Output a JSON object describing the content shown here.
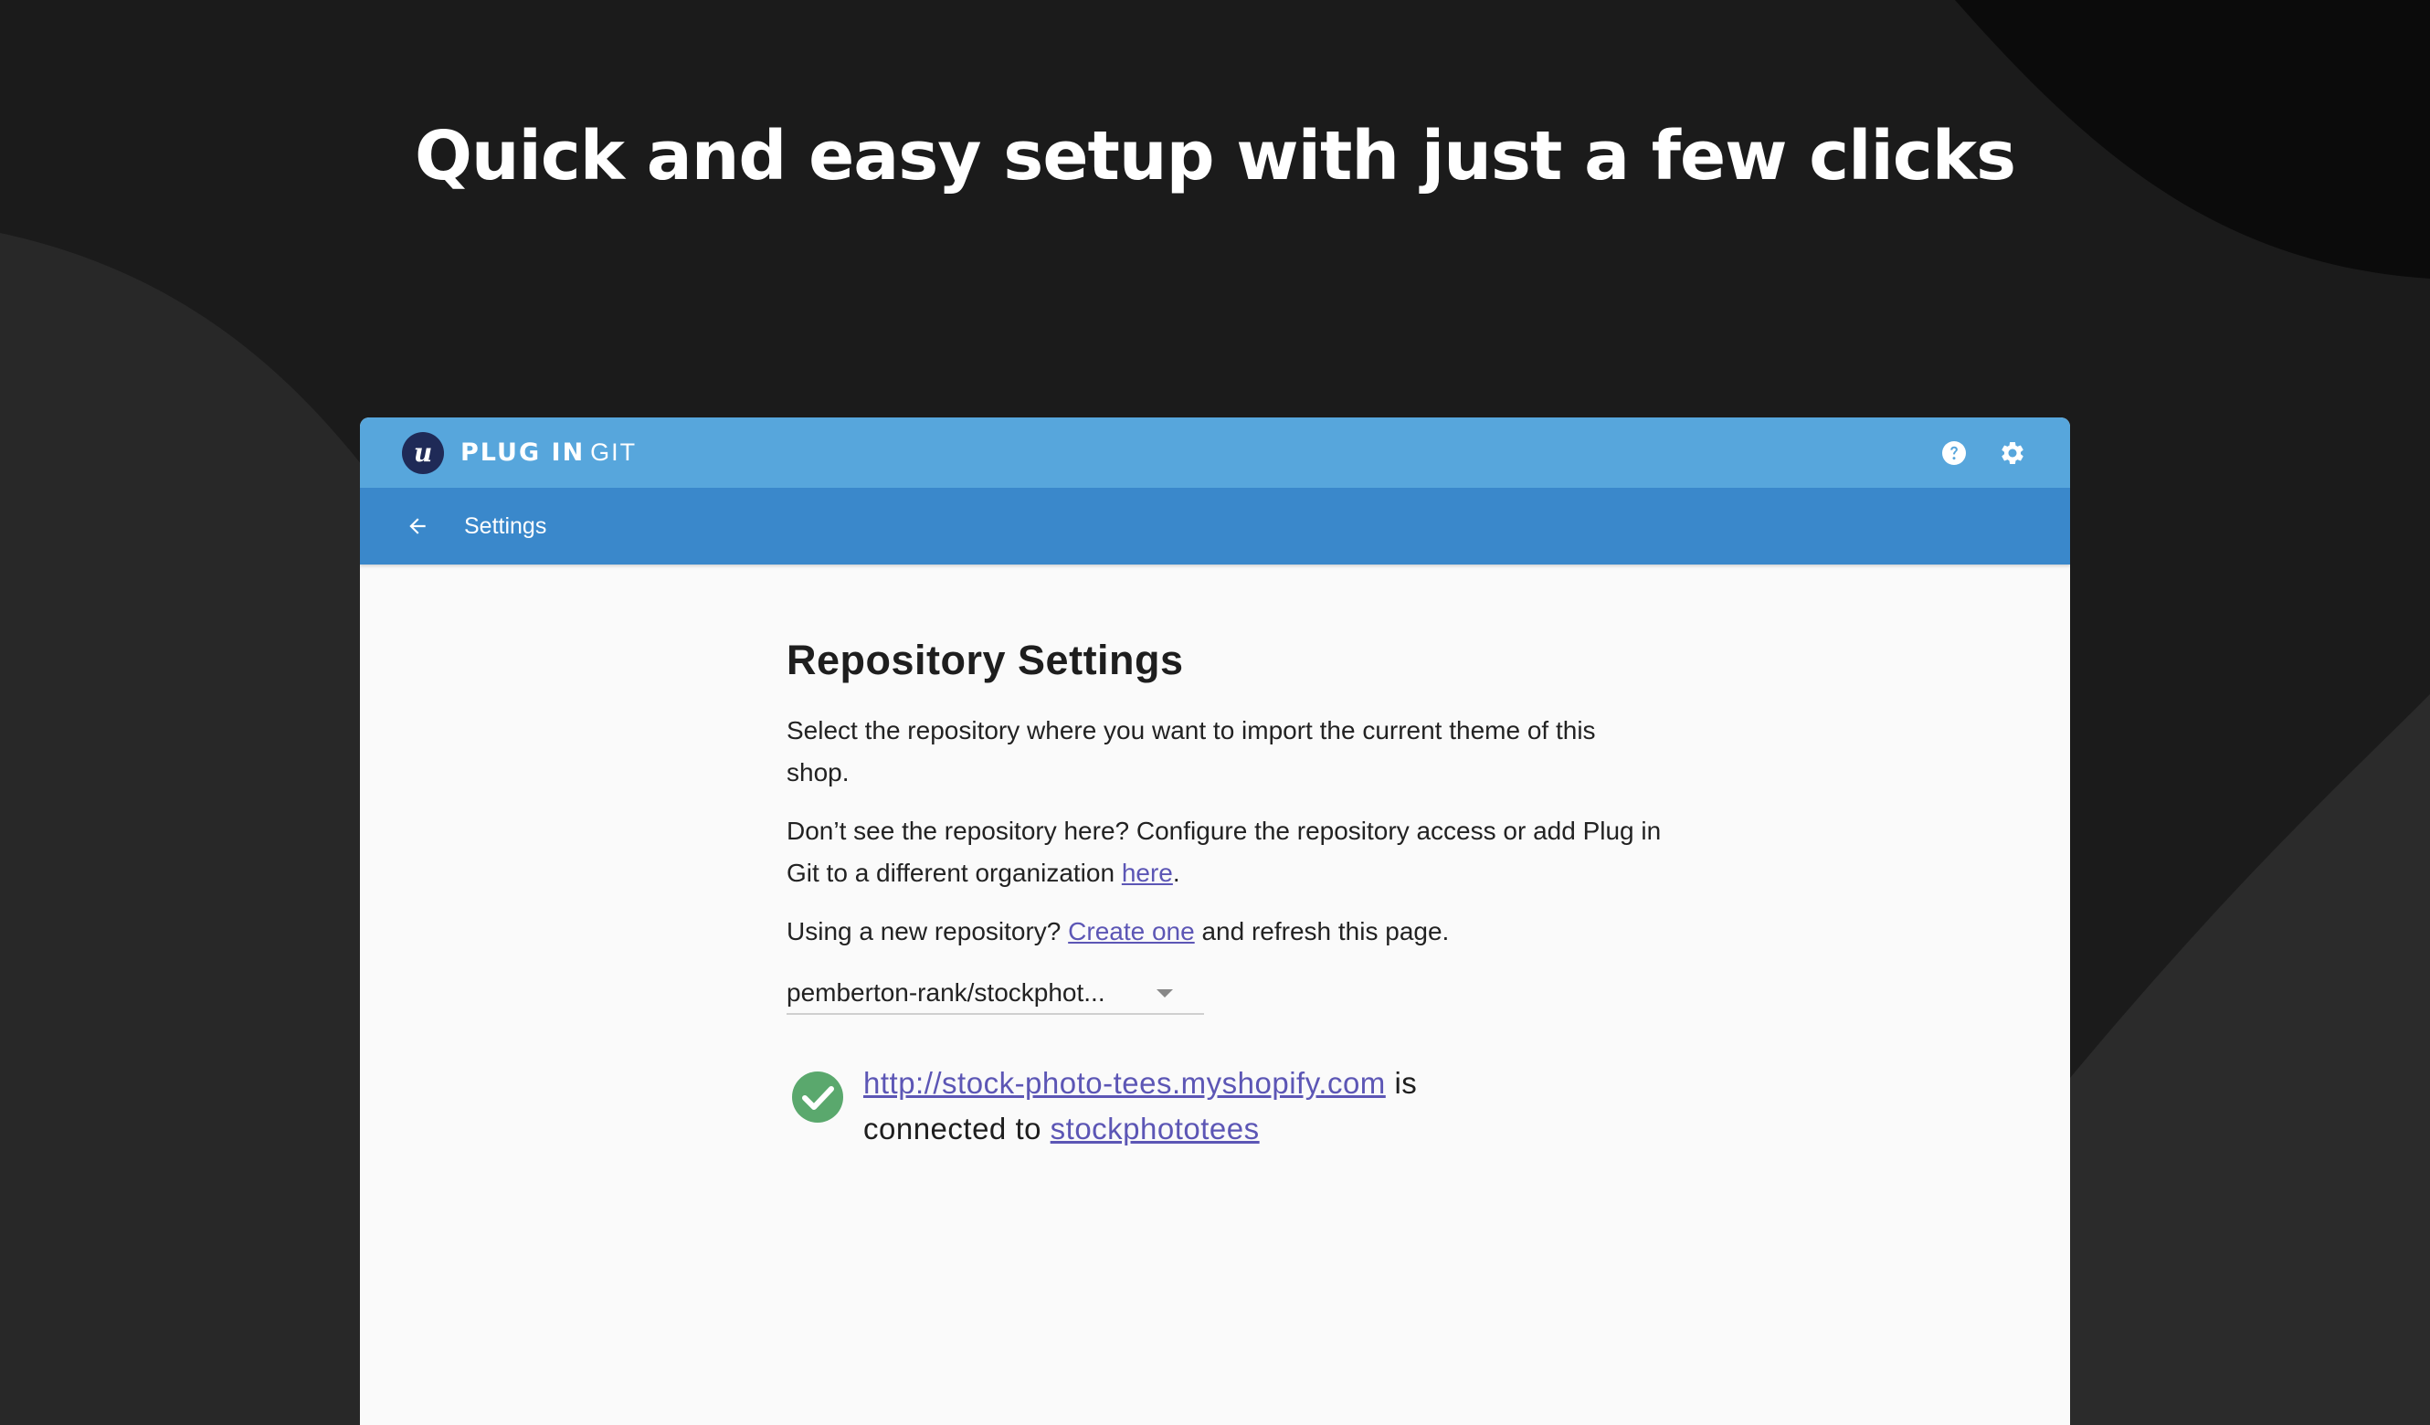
{
  "headline": "Quick and easy setup with just a few clicks",
  "colors": {
    "background": "#1b1b1b",
    "topbar": "#57a6dc",
    "subbar": "#3a88cb",
    "link": "#5c56b5",
    "success": "#5aa86d"
  },
  "app": {
    "logo_letter": "u",
    "brand_strong": "PLUG IN",
    "brand_light": "GIT",
    "icons": [
      "help-icon",
      "gear-icon"
    ]
  },
  "subbar": {
    "back_icon": "arrow-left-icon",
    "title": "Settings"
  },
  "content": {
    "title": "Repository Settings",
    "intro": "Select the repository where you want to import the current theme of this shop.",
    "access_before": "Don’t see the repository here? Configure the repository access or add Plug in Git to a different organization ",
    "access_link": "here",
    "access_after": ".",
    "new_before": "Using a new repository? ",
    "new_link": "Create one",
    "new_after": " and refresh this page.",
    "select_value": "pemberton-rank/stockphot...",
    "status_url": "http://stock-photo-tees.myshopify.com",
    "status_is": " is",
    "status_connected": "connected to ",
    "status_repo": "stockphototees"
  }
}
